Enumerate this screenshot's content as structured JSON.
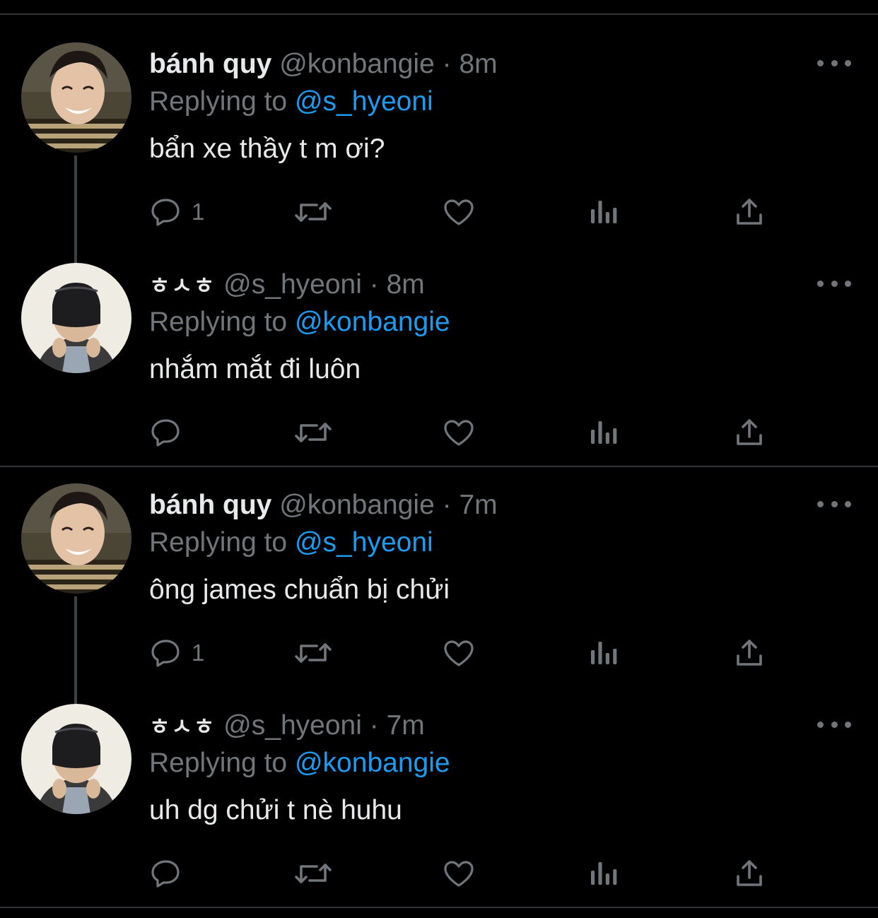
{
  "colors": {
    "background": "#000000",
    "text": "#e7e9ea",
    "muted": "#71767b",
    "link": "#1d9bf0",
    "divider": "#2f3336"
  },
  "tweets": [
    {
      "name": "bánh quy",
      "handle": "@konbangie",
      "separator": "·",
      "time": "8m",
      "replying_prefix": "Replying to",
      "replying_to": "@s_hyeoni",
      "text": "bẩn xe thầy t m ơi?",
      "reply_count": "1",
      "avatar": "striped-shirt-smiling-avatar",
      "icons": [
        "reply-icon",
        "retweet-icon",
        "like-icon",
        "views-icon",
        "share-icon",
        "more-icon"
      ]
    },
    {
      "name": "ㅎㅅㅎ",
      "handle": "@s_hyeoni",
      "separator": "·",
      "time": "8m",
      "replying_prefix": "Replying to",
      "replying_to": "@konbangie",
      "text": "nhắm mắt đi luôn",
      "reply_count": "",
      "avatar": "masked-face-avatar",
      "icons": [
        "reply-icon",
        "retweet-icon",
        "like-icon",
        "views-icon",
        "share-icon",
        "more-icon"
      ]
    },
    {
      "name": "bánh quy",
      "handle": "@konbangie",
      "separator": "·",
      "time": "7m",
      "replying_prefix": "Replying to",
      "replying_to": "@s_hyeoni",
      "text": "ông james chuẩn bị chửi",
      "reply_count": "1",
      "avatar": "striped-shirt-smiling-avatar",
      "icons": [
        "reply-icon",
        "retweet-icon",
        "like-icon",
        "views-icon",
        "share-icon",
        "more-icon"
      ]
    },
    {
      "name": "ㅎㅅㅎ",
      "handle": "@s_hyeoni",
      "separator": "·",
      "time": "7m",
      "replying_prefix": "Replying to",
      "replying_to": "@konbangie",
      "text": "uh dg chửi t nè huhu",
      "reply_count": "",
      "avatar": "masked-face-avatar",
      "icons": [
        "reply-icon",
        "retweet-icon",
        "like-icon",
        "views-icon",
        "share-icon",
        "more-icon"
      ]
    }
  ]
}
